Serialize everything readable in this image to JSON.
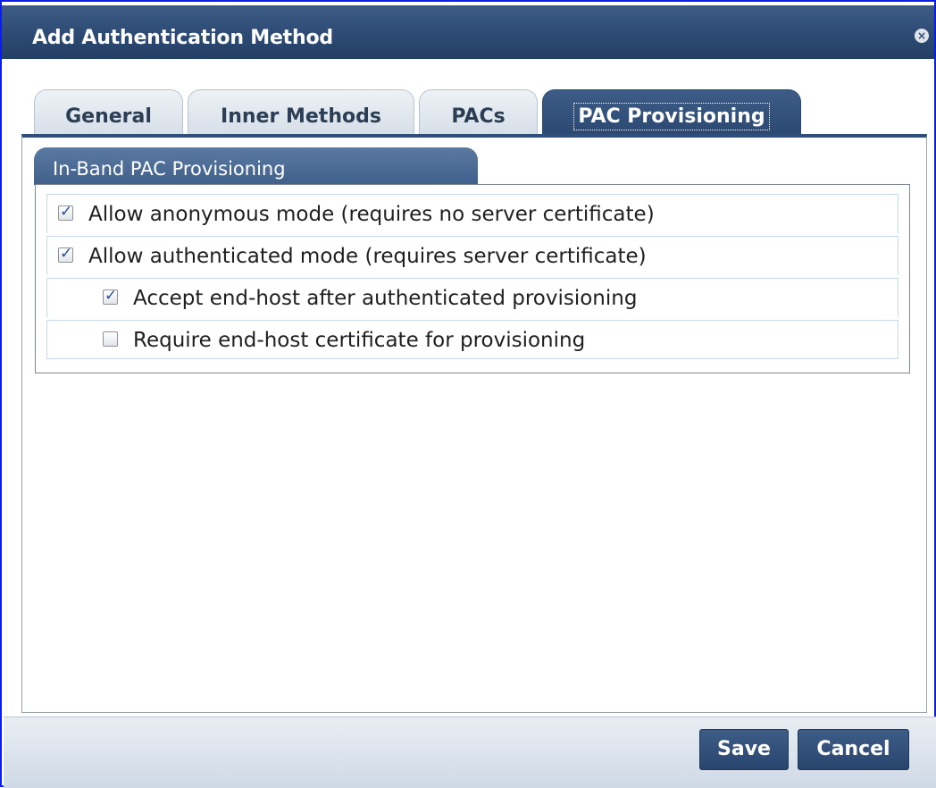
{
  "dialog": {
    "title": "Add Authentication Method",
    "close_icon": "close-icon",
    "close_glyph": "×"
  },
  "tabs": [
    {
      "label": "General",
      "active": false
    },
    {
      "label": "Inner Methods",
      "active": false
    },
    {
      "label": "PACs",
      "active": false
    },
    {
      "label": "PAC Provisioning",
      "active": true
    }
  ],
  "section": {
    "title": "In-Band PAC Provisioning",
    "options": [
      {
        "label": "Allow anonymous mode (requires no server certificate)",
        "checked": true,
        "mark": "✓"
      },
      {
        "label": "Allow authenticated mode (requires server certificate)",
        "checked": true,
        "mark": "✓"
      },
      {
        "label": "Accept end-host after authenticated provisioning",
        "checked": true,
        "mark": "✓"
      },
      {
        "label": "Require end-host certificate for provisioning",
        "checked": false,
        "mark": ""
      }
    ]
  },
  "footer": {
    "save_label": "Save",
    "cancel_label": "Cancel"
  }
}
